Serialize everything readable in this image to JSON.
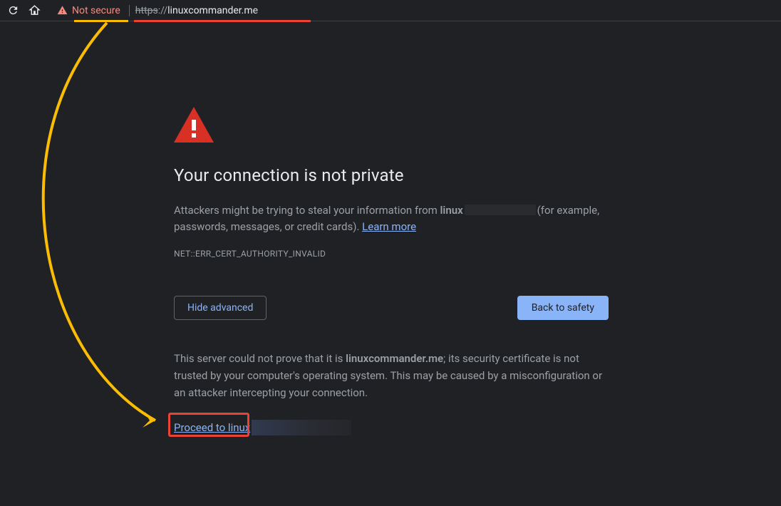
{
  "toolbar": {
    "not_secure_label": "Not secure",
    "url_protocol": "https",
    "url_separator": "://",
    "url_visible": "linux"
  },
  "page": {
    "heading": "Your connection is not private",
    "warn_prefix": "Attackers might be trying to steal your information from ",
    "warn_domain_partial": "linux",
    "warn_suffix_1": "(for example, passwords, messages, or credit cards). ",
    "learn_more": "Learn more",
    "error_code": "NET::ERR_CERT_AUTHORITY_INVALID",
    "hide_advanced": "Hide advanced",
    "back_to_safety": "Back to safety",
    "details_1": "This server could not prove that it is ",
    "details_domain": "linuxcommander.me",
    "details_2": "; its security certificate is not trusted by your computer's operating system. This may be caused by a misconfiguration or an attacker intercepting your connection.",
    "proceed_label": "Proceed to linux"
  },
  "annotation": {
    "arrow_color": "#fbbc04",
    "underline_not_secure_color": "#fbbc04",
    "underline_url_color": "#ea4335",
    "highlight_box_color": "#ea4335"
  }
}
